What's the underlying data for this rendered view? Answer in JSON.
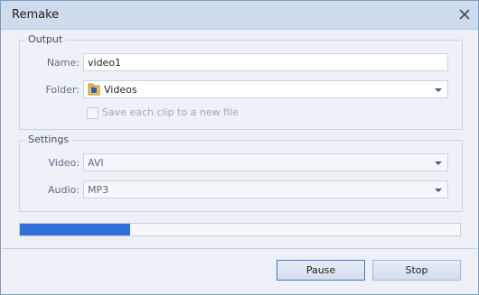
{
  "window": {
    "title": "Remake"
  },
  "output": {
    "legend": "Output",
    "name_label": "Name:",
    "name_value": "video1",
    "folder_label": "Folder:",
    "folder_value": "Videos",
    "folder_icon": "folder-video-icon",
    "checkbox_label": "Save each clip to a new file",
    "checkbox_checked": false
  },
  "settings": {
    "legend": "Settings",
    "video_label": "Video:",
    "video_value": "AVI",
    "audio_label": "Audio:",
    "audio_value": "MP3"
  },
  "progress": {
    "fraction": 0.25,
    "color": "#2f70db"
  },
  "buttons": {
    "pause": "Pause",
    "stop": "Stop"
  }
}
